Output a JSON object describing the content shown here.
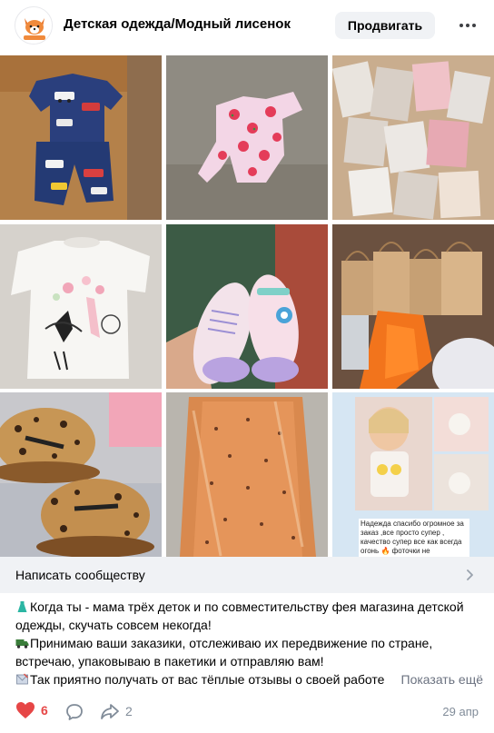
{
  "header": {
    "community_name": "Детская одежда/Модный лисенок",
    "promote_label": "Продвигать"
  },
  "photos": [
    {
      "subject": "kids pajama set with cars print"
    },
    {
      "subject": "watermelon print swimsuit"
    },
    {
      "subject": "pile of packaged clothes"
    },
    {
      "subject": "white t-shirt with girl print"
    },
    {
      "subject": "pink children sandals"
    },
    {
      "subject": "paper gift bags with orders"
    },
    {
      "subject": "leopard print caps with BOSTON text"
    },
    {
      "subject": "orange dress in plastic bag"
    },
    {
      "subject": "customer review collage"
    }
  ],
  "review_caption": "Надежда спасибо огромное за заказ ,все просто супер , качество супер все как всегда огонь 🔥 фоточки не",
  "message_row": {
    "label": "Написать сообществу"
  },
  "post": {
    "lines": [
      {
        "emoji": "dress-emoji",
        "text": "Когда ты - мама трёх деток и по совместительству фея магазина детской"
      },
      {
        "emoji": "",
        "text": "одежды, скучать совсем некогда!"
      },
      {
        "emoji": "truck-emoji",
        "text": "Принимаю ваши заказики, отслеживаю их передвижение по стране,"
      },
      {
        "emoji": "",
        "text": "встречаю, упаковываю в пакетики и отправляю вам!"
      },
      {
        "emoji": "envelope-emoji",
        "text": "Так приятно получать от вас тёплые отзывы о своей работе"
      }
    ],
    "show_more": "Показать ещё"
  },
  "footer": {
    "likes": "6",
    "shares": "2",
    "date": "29 апр"
  },
  "colors": {
    "like_red": "#e64646",
    "muted": "#818c99",
    "button_bg": "#f0f2f5"
  }
}
